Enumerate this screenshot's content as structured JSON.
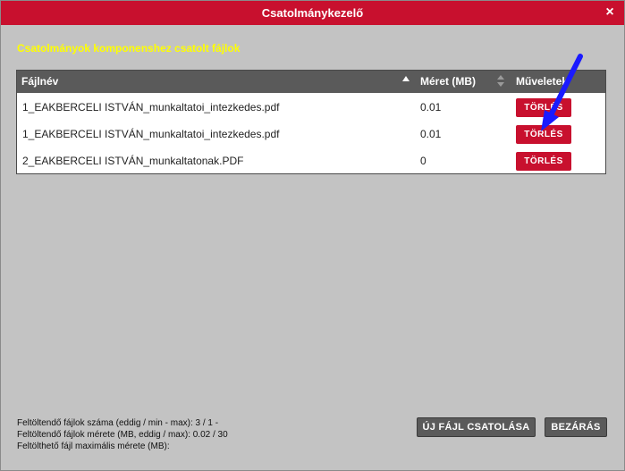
{
  "window": {
    "title": "Csatolmánykezelő",
    "close_icon": "×"
  },
  "section_title": "Csatolmányok komponenshez csatolt fájlok",
  "table": {
    "headers": {
      "name": "Fájlnév",
      "size": "Méret (MB)",
      "actions": "Műveletek"
    },
    "rows": [
      {
        "name": "1_EAKBERCELI ISTVÁN_munkaltatoi_intezkedes.pdf",
        "size": "0.01",
        "action": "TÖRLÉS"
      },
      {
        "name": "1_EAKBERCELI ISTVÁN_munkaltatoi_intezkedes.pdf",
        "size": "0.01",
        "action": "TÖRLÉS"
      },
      {
        "name": "2_EAKBERCELI ISTVÁN_munkaltatonak.PDF",
        "size": "0",
        "action": "TÖRLÉS"
      }
    ]
  },
  "footer": {
    "line1": "Feltöltendő fájlok száma (eddig / min - max): 3 / 1 -",
    "line2": "Feltöltendő fájlok mérete (MB, eddig / max): 0.02 / 30",
    "line3": "Feltölthető fájl maximális mérete (MB):"
  },
  "buttons": {
    "attach": "ÚJ FÁJL CSATOLÁSA",
    "close": "BEZÁRÁS"
  },
  "colors": {
    "accent_red": "#c8102e",
    "header_gray": "#5a5a5a",
    "section_title_yellow": "#ffff00",
    "annotation_arrow_blue": "#1a1aff"
  }
}
